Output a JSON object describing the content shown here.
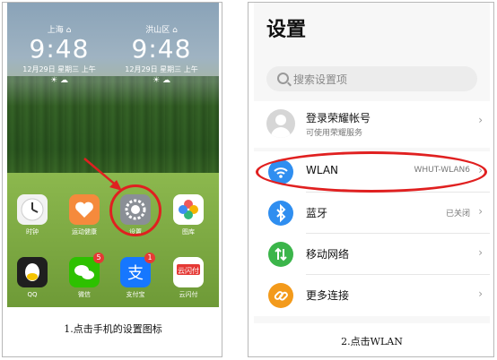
{
  "left_panel": {
    "caption": "1.点击手机的设置图标",
    "clocks": [
      {
        "city": "上海 ⌂",
        "time": "9:48",
        "date": "12月29日 星期三 上午",
        "weather": "☀ ☁"
      },
      {
        "city": "洪山区 ⌂",
        "time": "9:48",
        "date": "12月29日 星期三 上午",
        "weather": "☀ ☁"
      }
    ],
    "apps": [
      {
        "label": "时钟",
        "icon": "clock-icon",
        "color": "#f2f2f2"
      },
      {
        "label": "运动健康",
        "icon": "health-heart-icon",
        "color": "#f58a3c"
      },
      {
        "label": "设置",
        "icon": "settings-gear-icon",
        "color": "#8a8f96"
      },
      {
        "label": "图库",
        "icon": "gallery-flower-icon",
        "color": "#ffffff"
      },
      {
        "label": "QQ",
        "icon": "qq-penguin-icon",
        "color": "#1f1f1f",
        "badge": ""
      },
      {
        "label": "微信",
        "icon": "wechat-icon",
        "color": "#2dc100",
        "badge": "5"
      },
      {
        "label": "支付宝",
        "icon": "alipay-icon",
        "color": "#1677ff",
        "badge": "1"
      },
      {
        "label": "云闪付",
        "icon": "unionpay-icon",
        "color": "#ffffff",
        "badge": ""
      }
    ]
  },
  "right_panel": {
    "caption": "2.点击WLAN",
    "title": "设置",
    "search_placeholder": "搜索设置项",
    "account": {
      "title": "登录荣耀帐号",
      "subtitle": "可使用荣耀服务"
    },
    "rows": [
      {
        "label": "WLAN",
        "value": "WHUT-WLAN6",
        "icon": "wifi-icon",
        "color": "#2f8ef0"
      },
      {
        "label": "蓝牙",
        "value": "已关闭",
        "icon": "bluetooth-icon",
        "color": "#2f8ef0"
      },
      {
        "label": "移动网络",
        "value": "",
        "icon": "mobile-network-icon",
        "color": "#3bb54a"
      },
      {
        "label": "更多连接",
        "value": "",
        "icon": "more-connections-icon",
        "color": "#f39a1b"
      }
    ],
    "chevron": "›"
  },
  "highlight_color": "#e02020"
}
